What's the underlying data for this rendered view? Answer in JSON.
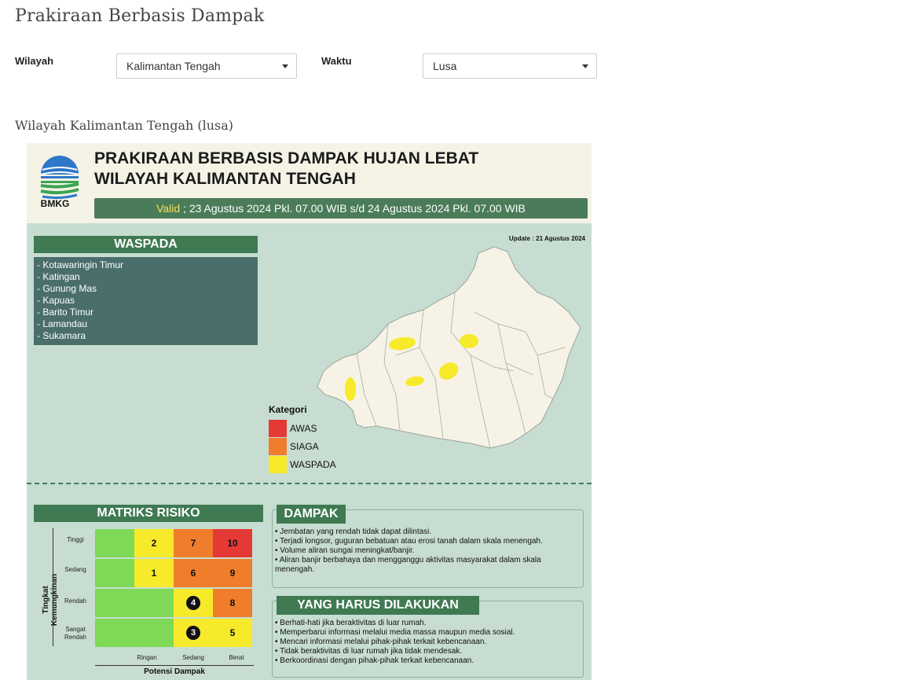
{
  "page": {
    "title": "Prakiraan Berbasis Dampak",
    "subtitle": "Wilayah Kalimantan Tengah (lusa)"
  },
  "filters": {
    "wilayah_label": "Wilayah",
    "wilayah_value": "Kalimantan Tengah",
    "waktu_label": "Waktu",
    "waktu_value": "Lusa"
  },
  "infographic": {
    "logo_text": "BMKG",
    "title_line1": "PRAKIRAAN BERBASIS DAMPAK HUJAN LEBAT",
    "title_line2": "WILAYAH KALIMANTAN TENGAH",
    "valid_label": "Valid",
    "valid_text": " ; 23 Agustus 2024 Pkl. 07.00 WIB s/d 24 Agustus 2024 Pkl. 07.00 WIB",
    "update": "Update : 21 Agustus 2024",
    "waspada_header": "WASPADA",
    "waspada_items": [
      "- Kotawaringin Timur",
      "- Katingan",
      "- Gunung Mas",
      "- Kapuas",
      "- Barito Timur",
      "- Lamandau",
      "- Sukamara"
    ],
    "kategori": {
      "title": "Kategori",
      "items": [
        {
          "label": "AWAS",
          "color": "#e53935"
        },
        {
          "label": "SIAGA",
          "color": "#f07d2b"
        },
        {
          "label": "WASPADA",
          "color": "#f7ea2a"
        }
      ]
    },
    "matriks": {
      "header": "MATRIKS RISIKO",
      "y_axis": "Tingkat Kemungkinan",
      "x_axis": "Potensi Dampak",
      "rows": [
        "Tinggi",
        "Sedang",
        "Rendah",
        "Sangat Rendah"
      ],
      "cols": [
        "Ringan",
        "Sedang",
        "Berat"
      ],
      "cells": [
        [
          "",
          "2",
          "7",
          "10"
        ],
        [
          "",
          "1",
          "6",
          "9"
        ],
        [
          "",
          "",
          "4",
          "8"
        ],
        [
          "",
          "",
          "3",
          "5"
        ]
      ],
      "colors": {
        "green": "#7ed957",
        "yellow": "#f7ea2a",
        "orange": "#f07d2b",
        "red": "#e53935"
      }
    },
    "dampak": {
      "header": "DAMPAK",
      "items": [
        "• Jembatan yang rendah tidak dapat dilintasi.",
        "• Terjadi longsor, guguran bebatuan atau erosi tanah dalam skala menengah.",
        "• Volume aliran sungai meningkat/banjir.",
        "• Aliran banjir berbahaya dan mengganggu aktivitas masyarakat dalam skala menengah."
      ]
    },
    "yang_harus": {
      "header": "YANG HARUS DILAKUKAN",
      "items": [
        "• Berhati-hati jika beraktivitas di luar rumah.",
        "• Memperbarui informasi melalui media massa maupun media sosial.",
        "• Mencari informasi melalui pihak-pihak terkait kebencanaan.",
        "• Tidak beraktivitas di luar rumah jika tidak mendesak.",
        "• Berkoordinasi dengan pihak-pihak terkait kebencanaan."
      ]
    }
  }
}
